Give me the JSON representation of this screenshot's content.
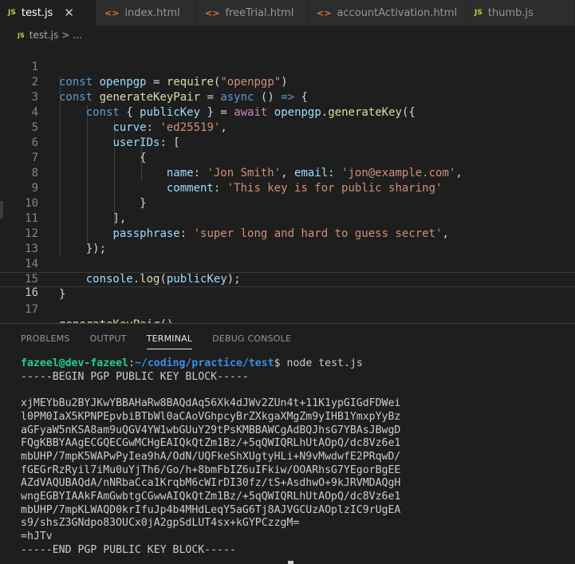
{
  "tabs": [
    {
      "icon": "JS",
      "label": "test.js",
      "active": true
    },
    {
      "icon": "<>",
      "label": "index.html",
      "active": false
    },
    {
      "icon": "<>",
      "label": "freeTrial.html",
      "active": false
    },
    {
      "icon": "<>",
      "label": "accountActivation.html",
      "active": false
    },
    {
      "icon": "JS",
      "label": "thumb.js",
      "active": false
    }
  ],
  "close_glyph": "✕",
  "breadcrumb": {
    "icon": "JS",
    "file": "test.js",
    "sep": ">",
    "rest": "..."
  },
  "line_numbers": [
    "1",
    "2",
    "3",
    "4",
    "5",
    "6",
    "7",
    "8",
    "9",
    "10",
    "11",
    "12",
    "13",
    "14",
    "15",
    "16",
    "17"
  ],
  "current_line": "16",
  "code": {
    "l1": [
      "const",
      " ",
      "openpgp",
      " = ",
      "require",
      "(",
      "\"openpgp\"",
      ")"
    ],
    "l2": [
      "const",
      " ",
      "generateKeyPair",
      " = ",
      "async",
      " () ",
      "=>",
      " {"
    ],
    "l3": [
      "    ",
      "const",
      " { ",
      "publicKey",
      " } = ",
      "await",
      " ",
      "openpgp",
      ".",
      "generateKey",
      "({"
    ],
    "l4": [
      "        ",
      "curve",
      ": ",
      "'ed25519'",
      ","
    ],
    "l5": [
      "        ",
      "userIDs",
      ": ["
    ],
    "l6": [
      "            {"
    ],
    "l7": [
      "                ",
      "name",
      ": ",
      "'Jon Smith'",
      ", ",
      "email",
      ": ",
      "'jon@example.com'",
      ","
    ],
    "l8": [
      "                ",
      "comment",
      ": ",
      "'This key is for public sharing'"
    ],
    "l9": [
      "            }"
    ],
    "l10": [
      "        ],"
    ],
    "l11": [
      "        ",
      "passphrase",
      ": ",
      "'super long and hard to guess secret'",
      ","
    ],
    "l12": [
      "    });"
    ],
    "l13": [
      ""
    ],
    "l14": [
      "    ",
      "console",
      ".",
      "log",
      "(",
      "publicKey",
      ");"
    ],
    "l15": [
      "}"
    ],
    "l16": [
      ""
    ],
    "l17": [
      "generateKeyPair",
      "()"
    ]
  },
  "panel": {
    "tabs": [
      "PROBLEMS",
      "OUTPUT",
      "TERMINAL",
      "DEBUG CONSOLE"
    ],
    "active_tab": "TERMINAL"
  },
  "terminal": {
    "prompt_user": "fazeel@dev-fazeel",
    "prompt_colon": ":",
    "prompt_path": "~/coding/practice/test",
    "prompt_dollar": "$ ",
    "command": "node test.js",
    "lines": [
      "-----BEGIN PGP PUBLIC KEY BLOCK-----",
      "",
      "xjMEYbBu2BYJKwYBBAHaRw8BAQdAq56Xk4dJWv2ZUn4t+11K1ypGIGdFDWei",
      "l0PM0IaX5KPNPEpvbiBTbWl0aCAoVGhpcyBrZXkgaXMgZm9yIHB1YmxpYyBz",
      "aGFyaW5nKSA8am9uQGV4YW1wbGUuY29tPsKMBBAWCgAdBQJhsG7YBAsJBwgD",
      "FQgKBBYAAgECGQECGwMCHgEAIQkQtZm1Bz/+5qQWIQRLhUtAOpQ/dc8Vz6e1",
      "mbUHP/7mpK5WAPwPyIea9hA/OdN/UQFkeShXUgtyHLi+N9vMwdwfE2PRqwD/",
      "fGEGrRzRyil7iMu0uYjTh6/Go/h+8bmFbIZ6uIFkiw/OOARhsG7YEgorBgEE",
      "AZdVAQUBAQdA/nNRbaCca1KrqbM6cWIrDI30fz/tS+AsdhwO+9kJRVMDAQgH",
      "wngEGBYIAAkFAmGwbtgCGwwAIQkQtZm1Bz/+5qQWIQRLhUtAOpQ/dc8Vz6e1",
      "mbUHP/7mpKLWAQD0krIfuJp4b4MHdLeqY5aG6Tj8AJVGCUzAOplzIC9rUgEA",
      "s9/shsZ3GNdpo83OUCx0jA2gpSdLUT4sx+kGYPCzzgM=",
      "=hJTv",
      "-----END PGP PUBLIC KEY BLOCK-----"
    ]
  },
  "colors": {
    "editor_bg": "#1e1e1e",
    "keyword": "#569cd6",
    "variable": "#9cdcfe",
    "function": "#dcdcaa",
    "string": "#ce9178",
    "control": "#c586c0",
    "prompt_user": "#23d18b",
    "prompt_path": "#3b8eea"
  }
}
